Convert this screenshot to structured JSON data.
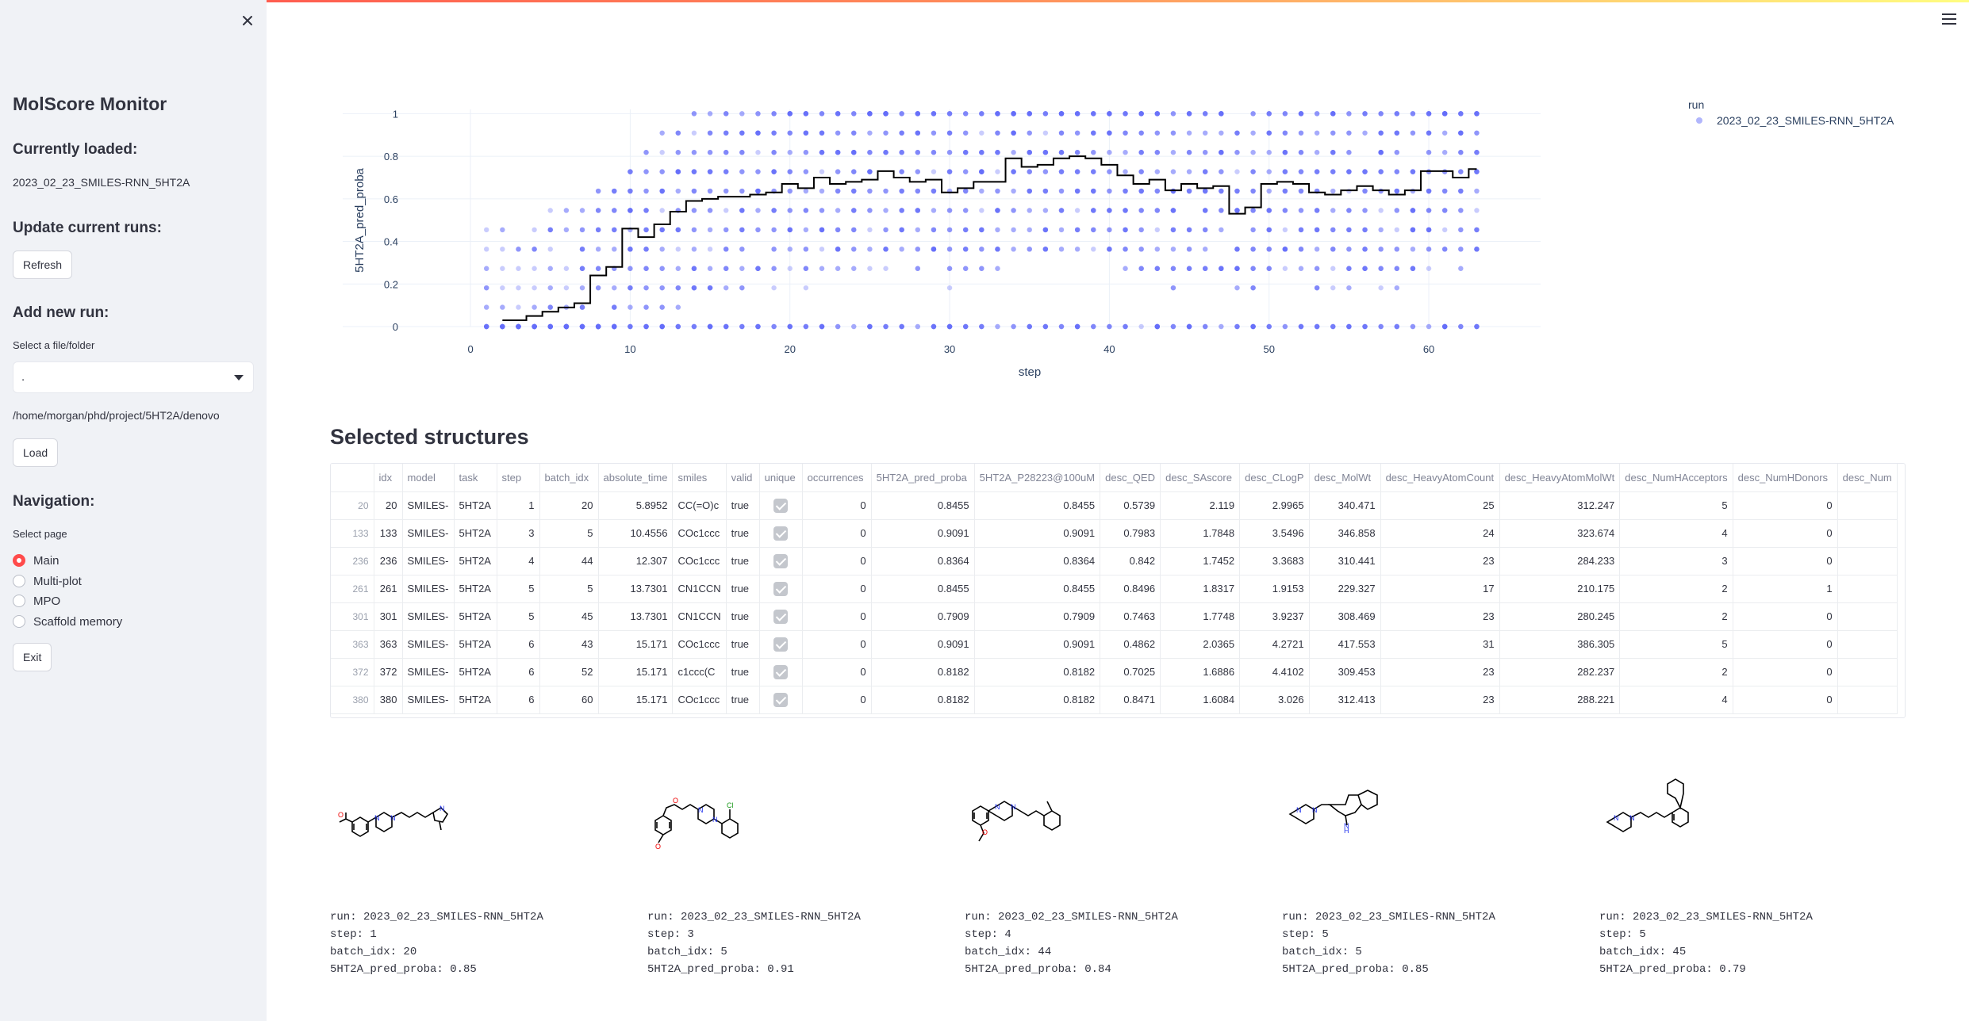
{
  "sidebar": {
    "title": "MolScore Monitor",
    "currently_loaded_heading": "Currently loaded:",
    "currently_loaded_value": "2023_02_23_SMILES-RNN_5HT2A",
    "update_heading": "Update current runs:",
    "refresh_label": "Refresh",
    "add_run_heading": "Add new run:",
    "file_select_label": "Select a file/folder",
    "file_select_value": ".",
    "path_text": "/home/morgan/phd/project/5HT2A/denovo",
    "load_label": "Load",
    "navigation_heading": "Navigation:",
    "select_page_label": "Select page",
    "pages": [
      {
        "label": "Main",
        "selected": true
      },
      {
        "label": "Multi-plot",
        "selected": false
      },
      {
        "label": "MPO",
        "selected": false
      },
      {
        "label": "Scaffold memory",
        "selected": false
      }
    ],
    "exit_label": "Exit"
  },
  "chart_data": {
    "type": "scatter",
    "title": "",
    "xlabel": "step",
    "ylabel": "5HT2A_pred_proba",
    "xlim": [
      -8,
      67
    ],
    "ylim": [
      0,
      1.02
    ],
    "x_ticks": [
      0,
      10,
      20,
      30,
      40,
      50,
      60
    ],
    "y_ticks": [
      0,
      0.2,
      0.4,
      0.6,
      0.8,
      1
    ],
    "legend_title": "run",
    "legend_position": "top-right",
    "colors": {
      "points": "#636efa",
      "mean_line": "#000000"
    },
    "series": [
      {
        "name": "2023_02_23_SMILES-RNN_5HT2A",
        "kind": "points",
        "x_range": [
          1,
          63
        ]
      },
      {
        "kind": "mean_step_line",
        "x": [
          2,
          3,
          4,
          5,
          6,
          7,
          8,
          9,
          10,
          11,
          12,
          13,
          14,
          15,
          16,
          17,
          18,
          19,
          20,
          21,
          22,
          23,
          24,
          25,
          26,
          27,
          28,
          29,
          30,
          31,
          32,
          33,
          34,
          35,
          36,
          37,
          38,
          39,
          40,
          41,
          42,
          43,
          44,
          45,
          46,
          47,
          48,
          49,
          50,
          51,
          52,
          53,
          54,
          55,
          56,
          57,
          58,
          59,
          60,
          61,
          62,
          63
        ],
        "y": [
          0.03,
          0.03,
          0.05,
          0.07,
          0.09,
          0.11,
          0.24,
          0.28,
          0.46,
          0.42,
          0.48,
          0.54,
          0.59,
          0.6,
          0.61,
          0.61,
          0.62,
          0.63,
          0.67,
          0.65,
          0.7,
          0.67,
          0.68,
          0.69,
          0.73,
          0.7,
          0.68,
          0.69,
          0.63,
          0.65,
          0.68,
          0.68,
          0.79,
          0.75,
          0.76,
          0.79,
          0.8,
          0.79,
          0.76,
          0.71,
          0.67,
          0.69,
          0.64,
          0.67,
          0.65,
          0.66,
          0.53,
          0.56,
          0.67,
          0.68,
          0.67,
          0.63,
          0.62,
          0.64,
          0.66,
          0.64,
          0.62,
          0.64,
          0.73,
          0.73,
          0.7,
          0.74
        ]
      }
    ]
  },
  "section_title": "Selected structures",
  "table": {
    "columns": [
      "idx",
      "model",
      "task",
      "step",
      "batch_idx",
      "absolute_time",
      "smiles",
      "valid",
      "unique",
      "occurrences",
      "5HT2A_pred_proba",
      "5HT2A_P28223@100uM",
      "desc_QED",
      "desc_SAscore",
      "desc_CLogP",
      "desc_MolWt",
      "desc_HeavyAtomCount",
      "desc_HeavyAtomMolWt",
      "desc_NumHAcceptors",
      "desc_NumHDonors",
      "desc_Num"
    ],
    "rows": [
      [
        "20",
        "20",
        "SMILES-",
        "5HT2A",
        "1",
        "20",
        "5.8952",
        "CC(=O)c",
        "true",
        "check",
        "0",
        "0.8455",
        "0.8455",
        "0.5739",
        "2.119",
        "2.9965",
        "340.471",
        "25",
        "312.247",
        "5",
        "0",
        ""
      ],
      [
        "133",
        "133",
        "SMILES-",
        "5HT2A",
        "3",
        "5",
        "10.4556",
        "COc1ccc",
        "true",
        "check",
        "0",
        "0.9091",
        "0.9091",
        "0.7983",
        "1.7848",
        "3.5496",
        "346.858",
        "24",
        "323.674",
        "4",
        "0",
        ""
      ],
      [
        "236",
        "236",
        "SMILES-",
        "5HT2A",
        "4",
        "44",
        "12.307",
        "COc1ccc",
        "true",
        "check",
        "0",
        "0.8364",
        "0.8364",
        "0.842",
        "1.7452",
        "3.3683",
        "310.441",
        "23",
        "284.233",
        "3",
        "0",
        ""
      ],
      [
        "261",
        "261",
        "SMILES-",
        "5HT2A",
        "5",
        "5",
        "13.7301",
        "CN1CCN",
        "true",
        "check",
        "0",
        "0.8455",
        "0.8455",
        "0.8496",
        "1.8317",
        "1.9153",
        "229.327",
        "17",
        "210.175",
        "2",
        "1",
        ""
      ],
      [
        "301",
        "301",
        "SMILES-",
        "5HT2A",
        "5",
        "45",
        "13.7301",
        "CN1CCN",
        "true",
        "check",
        "0",
        "0.7909",
        "0.7909",
        "0.7463",
        "1.7748",
        "3.9237",
        "308.469",
        "23",
        "280.245",
        "2",
        "0",
        ""
      ],
      [
        "363",
        "363",
        "SMILES-",
        "5HT2A",
        "6",
        "43",
        "15.171",
        "COc1ccc",
        "true",
        "check",
        "0",
        "0.9091",
        "0.9091",
        "0.4862",
        "2.0365",
        "4.2721",
        "417.553",
        "31",
        "386.305",
        "5",
        "0",
        ""
      ],
      [
        "372",
        "372",
        "SMILES-",
        "5HT2A",
        "6",
        "52",
        "15.171",
        "c1ccc(C",
        "true",
        "check",
        "0",
        "0.8182",
        "0.8182",
        "0.7025",
        "1.6886",
        "4.4102",
        "309.453",
        "23",
        "282.237",
        "2",
        "0",
        ""
      ],
      [
        "380",
        "380",
        "SMILES-",
        "5HT2A",
        "6",
        "60",
        "15.171",
        "COc1ccc",
        "true",
        "check",
        "0",
        "0.8182",
        "0.8182",
        "0.8471",
        "1.6084",
        "3.026",
        "312.413",
        "23",
        "288.221",
        "4",
        "0",
        ""
      ]
    ]
  },
  "molecules": [
    {
      "run": "2023_02_23_SMILES-RNN_5HT2A",
      "step": "1",
      "batch_idx": "20",
      "pred": "0.85",
      "lines": [
        "run: 2023_02_23_SMILES-RNN_5HT2A",
        "step: 1",
        "batch_idx: 20",
        "5HT2A_pred_proba: 0.85"
      ]
    },
    {
      "run": "2023_02_23_SMILES-RNN_5HT2A",
      "step": "3",
      "batch_idx": "5",
      "pred": "0.91",
      "lines": [
        "run: 2023_02_23_SMILES-RNN_5HT2A",
        "step: 3",
        "batch_idx: 5",
        "5HT2A_pred_proba: 0.91"
      ]
    },
    {
      "run": "2023_02_23_SMILES-RNN_5HT2A",
      "step": "4",
      "batch_idx": "44",
      "pred": "0.84",
      "lines": [
        "run: 2023_02_23_SMILES-RNN_5HT2A",
        "step: 4",
        "batch_idx: 44",
        "5HT2A_pred_proba: 0.84"
      ]
    },
    {
      "run": "2023_02_23_SMILES-RNN_5HT2A",
      "step": "5",
      "batch_idx": "5",
      "pred": "0.85",
      "lines": [
        "run: 2023_02_23_SMILES-RNN_5HT2A",
        "step: 5",
        "batch_idx: 5",
        "5HT2A_pred_proba: 0.85"
      ]
    },
    {
      "run": "2023_02_23_SMILES-RNN_5HT2A",
      "step": "5",
      "batch_idx": "45",
      "pred": "0.79",
      "lines": [
        "run: 2023_02_23_SMILES-RNN_5HT2A",
        "step: 5",
        "batch_idx: 45",
        "5HT2A_pred_proba: 0.79"
      ]
    }
  ],
  "icons": {
    "close": "close-icon",
    "menu": "hamburger-menu-icon",
    "dropdown": "chevron-down-icon"
  }
}
